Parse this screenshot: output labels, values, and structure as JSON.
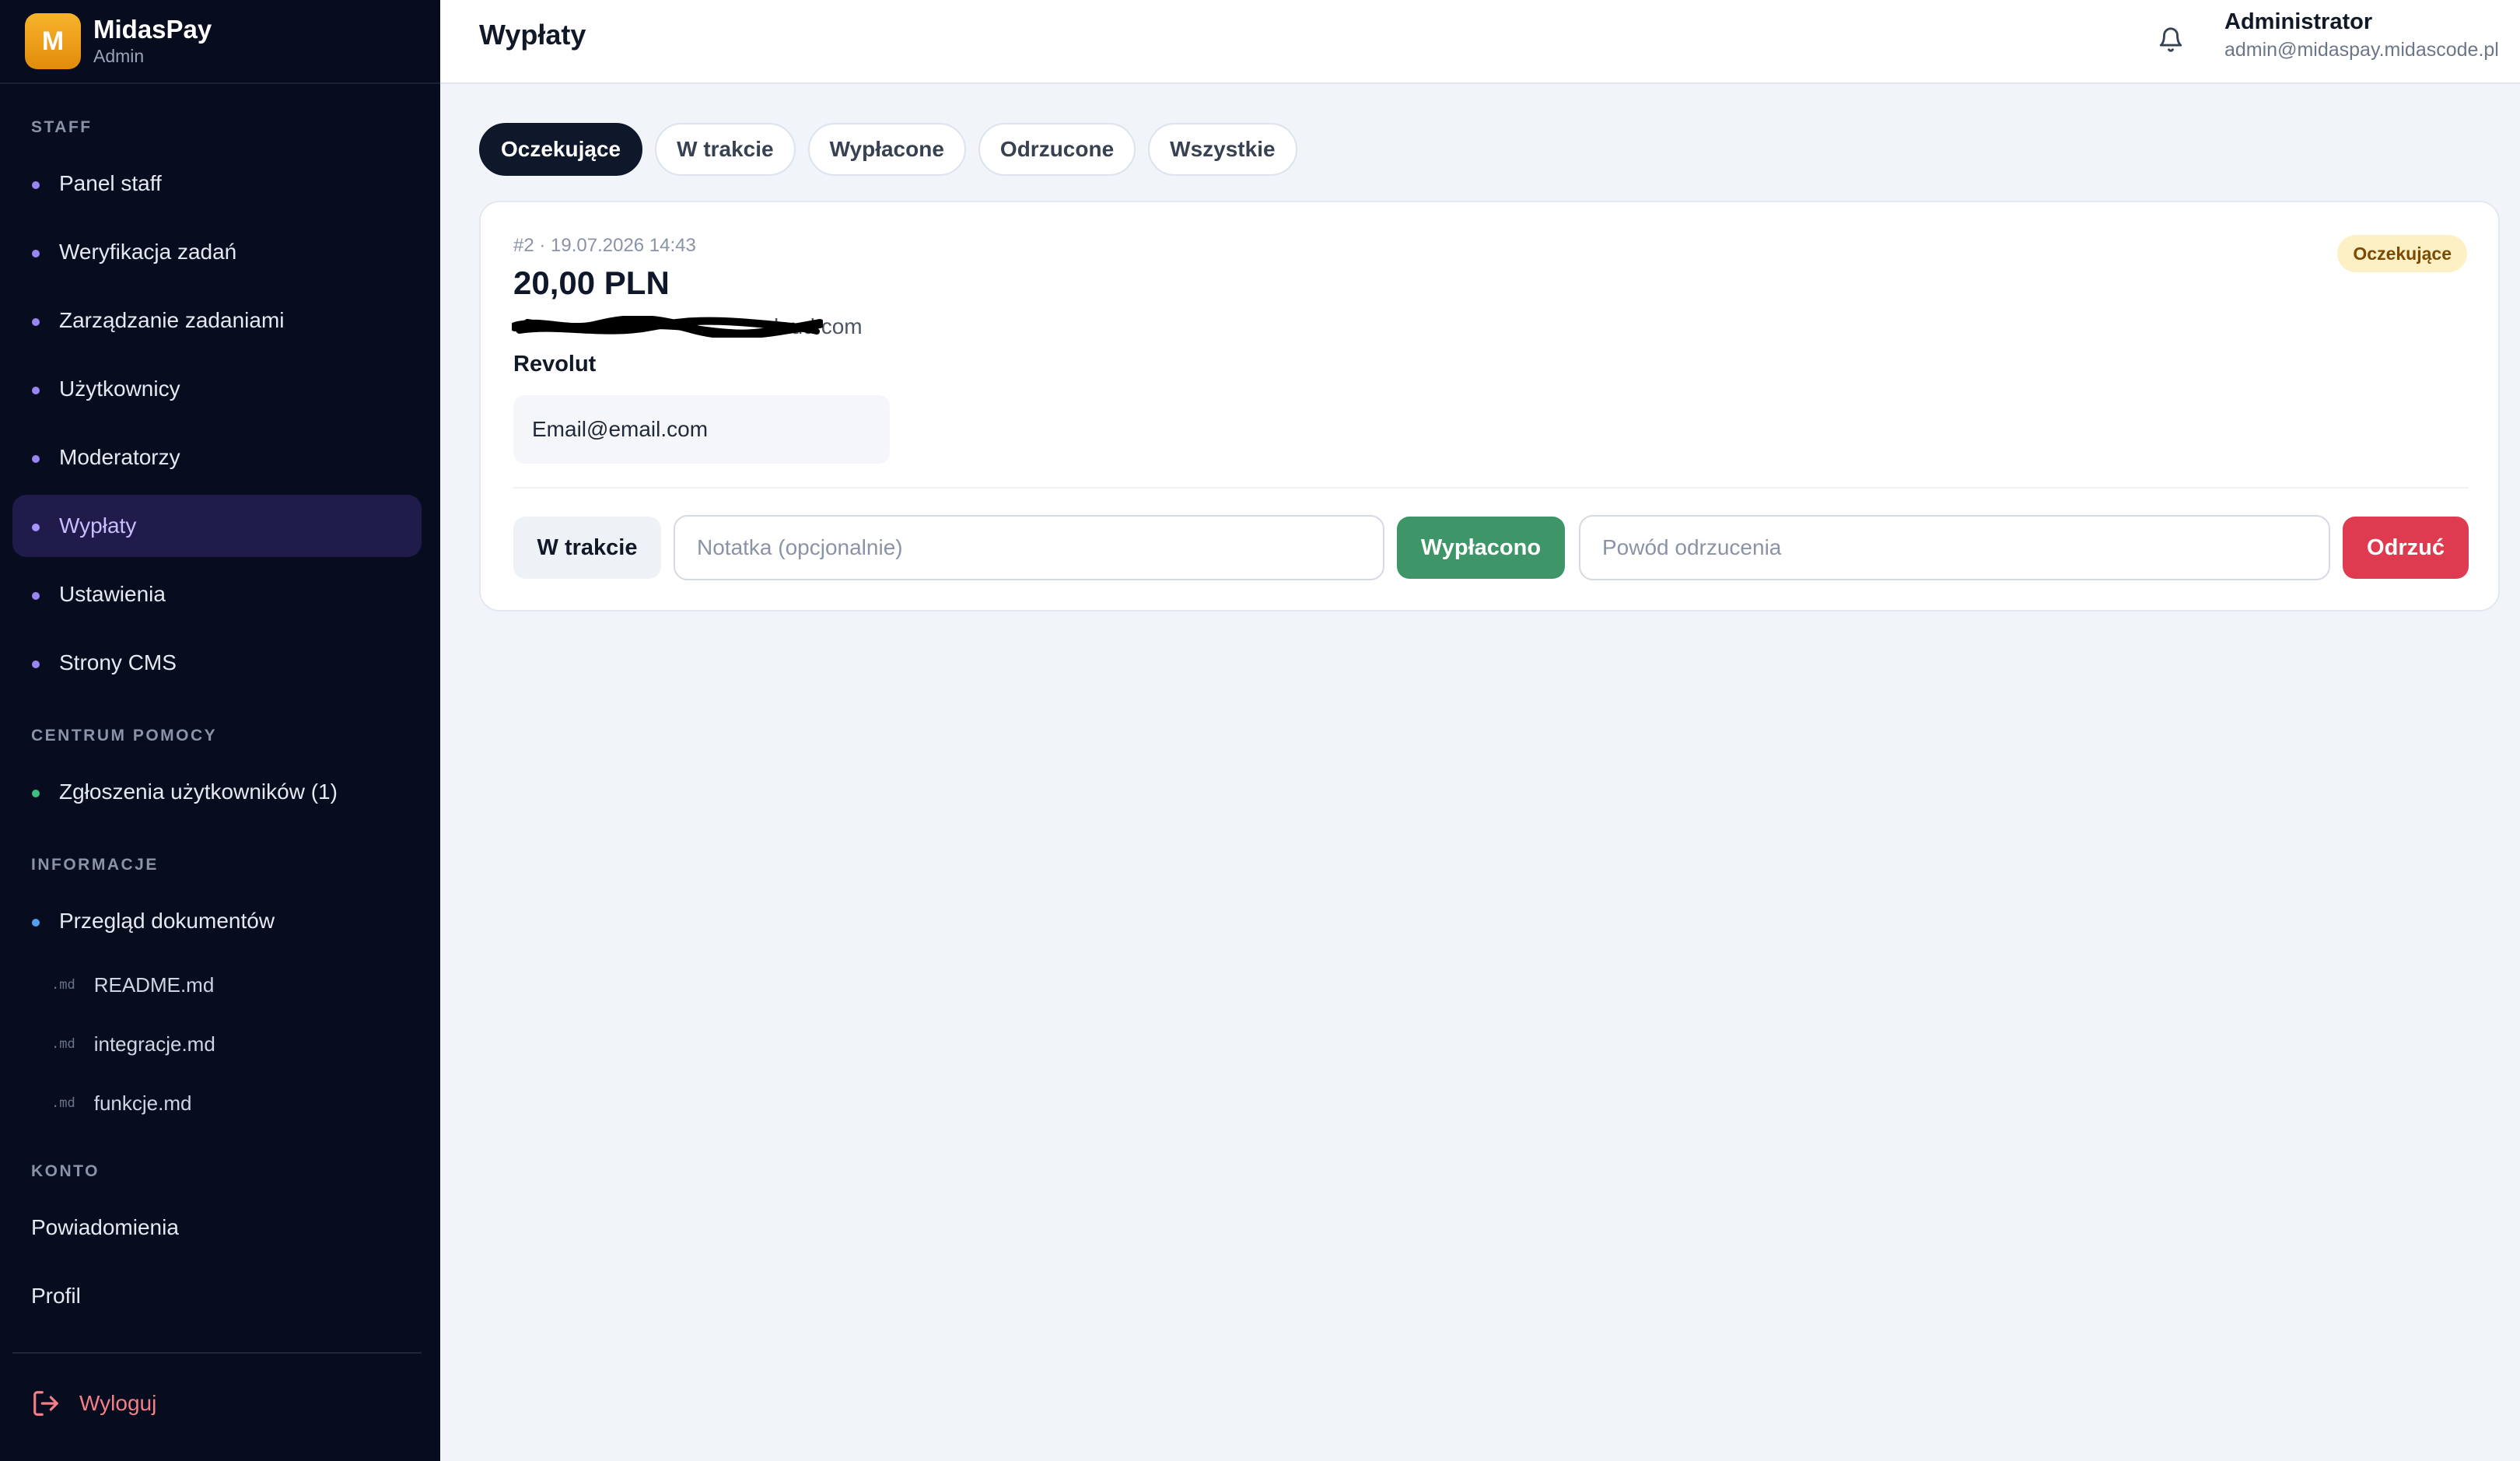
{
  "brand": {
    "logo_letter": "M",
    "name": "MidasPay",
    "subtitle": "Admin"
  },
  "sidebar": {
    "sections": {
      "staff": "STAFF",
      "help": "CENTRUM POMOCY",
      "info": "INFORMACJE",
      "account": "KONTO"
    },
    "staff_items": [
      {
        "label": "Panel staff",
        "active": false
      },
      {
        "label": "Weryfikacja zadań",
        "active": false
      },
      {
        "label": "Zarządzanie zadaniami",
        "active": false
      },
      {
        "label": "Użytkownicy",
        "active": false
      },
      {
        "label": "Moderatorzy",
        "active": false
      },
      {
        "label": "Wypłaty",
        "active": true
      },
      {
        "label": "Ustawienia",
        "active": false
      },
      {
        "label": "Strony CMS",
        "active": false
      }
    ],
    "help_items": [
      {
        "label": "Zgłoszenia użytkowników (1)"
      }
    ],
    "info_items": [
      {
        "label": "Przegląd dokumentów"
      }
    ],
    "docs": [
      {
        "ext": ".md",
        "label": "README.md"
      },
      {
        "ext": ".md",
        "label": "integracje.md"
      },
      {
        "ext": ".md",
        "label": "funkcje.md"
      }
    ],
    "account_items": [
      {
        "label": "Powiadomienia"
      },
      {
        "label": "Profil"
      }
    ],
    "logout_label": "Wyloguj"
  },
  "header": {
    "title": "Wypłaty",
    "user_name": "Administrator",
    "user_email": "admin@midaspay.midascode.pl"
  },
  "tabs": [
    {
      "label": "Oczekujące",
      "active": true
    },
    {
      "label": "W trakcie",
      "active": false
    },
    {
      "label": "Wypłacone",
      "active": false
    },
    {
      "label": "Odrzucone",
      "active": false
    },
    {
      "label": "Wszystkie",
      "active": false
    }
  ],
  "payout": {
    "meta": "#2 · 19.07.2026 14:43",
    "amount": "20,00 PLN",
    "email_visible_suffix": "loud.com",
    "method": "Revolut",
    "account": "Email@email.com",
    "status": "Oczekujące",
    "actions": {
      "in_progress_label": "W trakcie",
      "note_placeholder": "Notatka (opcjonalnie)",
      "paid_label": "Wypłacono",
      "reason_placeholder": "Powód odrzucenia",
      "reject_label": "Odrzuć"
    }
  },
  "colors": {
    "sidebar_bg": "#080c1f",
    "accent_purple": "#9a86f3",
    "paid_green": "#3e9567",
    "reject_red": "#de3b50",
    "pending_badge": "#fdf0c4"
  }
}
